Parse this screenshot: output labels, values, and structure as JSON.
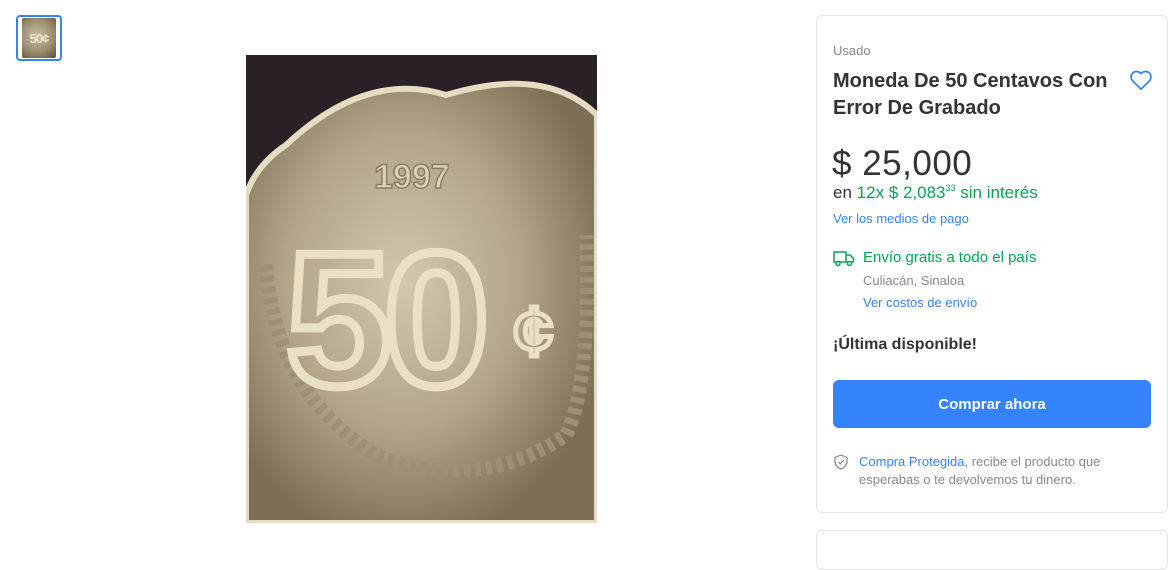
{
  "gallery": {
    "thumbnail_label": "50¢"
  },
  "photo": {
    "year": "1997",
    "denomination": "50",
    "cent_sign": "¢"
  },
  "product": {
    "condition": "Usado",
    "title": "Moneda De 50 Centavos Con Error De Grabado",
    "currency": "$",
    "price": "25,000"
  },
  "installments": {
    "prefix": "en",
    "count": "12x $ 2,083",
    "cents": "33",
    "suffix": "sin interés"
  },
  "payment_link": "Ver los medios de pago",
  "shipping": {
    "text": "Envío gratis a todo el país",
    "location": "Culiacán, Sinaloa",
    "cost_link": "Ver costos de envío"
  },
  "stock": "¡Última disponible!",
  "buy_button": "Comprar ahora",
  "protection": {
    "link": "Compra Protegida",
    "text": ", recibe el producto que esperabas o te devolvemos tu dinero."
  },
  "colors": {
    "accent": "#3483fa",
    "green": "#00a650"
  },
  "icons": {
    "favorite": "heart-outline-icon",
    "shipping": "truck-icon",
    "protection": "shield-check-icon"
  }
}
